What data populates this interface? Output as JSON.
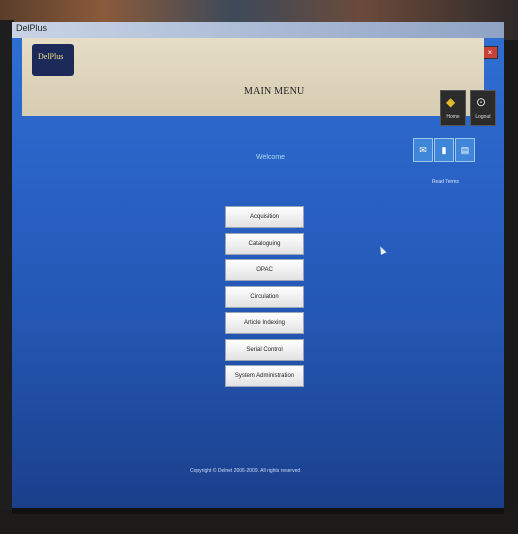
{
  "window": {
    "title": "DelPlus",
    "controls": [
      "–",
      "▫",
      "×"
    ]
  },
  "header": {
    "logo_text": "DelPlus",
    "main_title": "MAIN MENU",
    "home_label": "Home",
    "logout_label": "Logout"
  },
  "toolbar": {
    "button1_icon": "chat-icon",
    "button2_icon": "bookmark-icon",
    "button3_icon": "document-icon",
    "aux_label": "Read Terms"
  },
  "welcome_text": "Welcome",
  "menu": {
    "items": [
      "Acquisition",
      "Cataloguing",
      "OPAC",
      "Circulation",
      "Article Indexing",
      "Serial Control",
      "System Administration"
    ]
  },
  "footer": {
    "copyright": "Copyright © Delnet 2006-2009. All rights reserved"
  }
}
